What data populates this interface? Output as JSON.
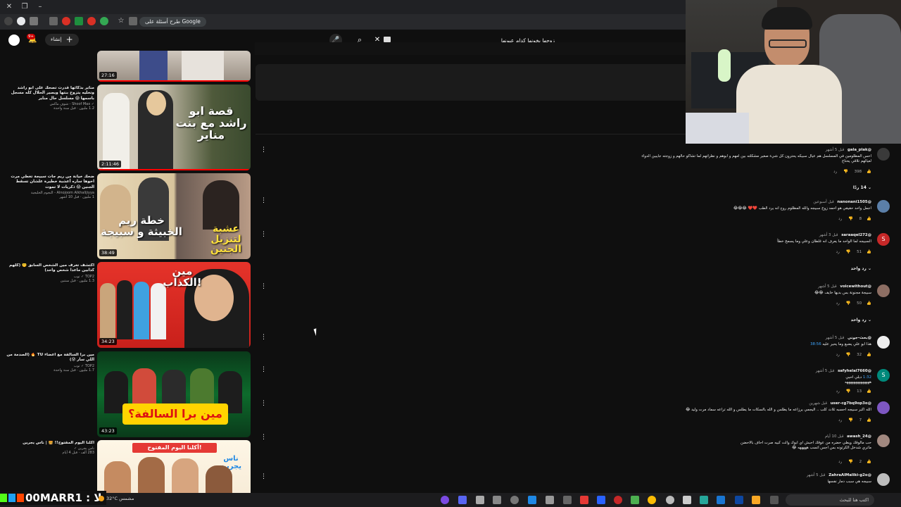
{
  "browser": {
    "ask_google_label": "طرح أسئلة على Google"
  },
  "youtube": {
    "search_value": "زوجها يخونها كدام عيونها",
    "create_label": "إنشاء",
    "notification_count": "9+"
  },
  "videos": [
    {
      "duration": "27:16",
      "title": "",
      "channel": "",
      "meta": ""
    },
    {
      "duration": "2:11:46",
      "thumb_text": "قصة ابو راشد مع بنت مناير",
      "title": "مناير بذكائها قدرت تصحك على ابو راشد وتخليه يتزوج بنتها ويصير الحلال كله مسجل باسمها 😱 مسلسل حال مناير",
      "channel": "✓ Shoof Max - شوف ماكس",
      "meta": "1.2 مليون · قبل سنة واحدة"
    },
    {
      "duration": "38:49",
      "thumb_text_left": "خطة ريم الخبيثة و سبيجة",
      "thumb_text_right": "عشبة لتنزيل الجنين",
      "title": "ضحك خيانة من ريم جات سبيجة تعطي مرت اخوها ساره أعشبة خطيرة علشان تسقط الجنين 😱 ذكريات لا تموت",
      "channel": "Alnojoom Alkhalijiyya - النجوم الخليجية",
      "meta": "1 مليون · قبل 10 أشهر"
    },
    {
      "duration": "34:23",
      "thumb_text": "مين الكذاب!",
      "title": "اكتشف تعرف مين الشخص السابق 🤫 (كلهم كذابين ماعدا شخص واحد)",
      "channel": "TOP2 ✓ توب",
      "meta": "1.3 مليون · قبل سنتين"
    },
    {
      "duration": "43:23",
      "thumb_text": "مين برا السالفة؟",
      "title": "مين برا السالفة مع اعضاء TU 🔥 (الصدمة من اللي سار 😰)",
      "channel": "TOP2 ✓ توب",
      "meta": "1.7 مليون · قبل سنة واحدة"
    },
    {
      "duration": "",
      "thumb_text": "أكلنا اليوم المفتوح!",
      "thumb_badge": "ناس يجرين",
      "title": "أكلنا اليوم المفتوح!! 🍔 | ناس يجرين",
      "channel": "ناس يجرين ✓",
      "meta": "283 ألف · قبل 4 أيام"
    }
  ],
  "comments": [
    {
      "author": "@gala_plak",
      "date": "قبل 5 أشهر",
      "text": "احس المظلومين في المسلسل هم عيال سبيكه يحترون كل شيء صغير مشكلته بين امهم و ابوهم و نظراتهم لما تشاكو حالهم و زوجته جايبين الدواء لعيالهم تلاقي يحتاج",
      "likes": "398",
      "reply_label": "رد",
      "replies": "14 ردًا",
      "avatar_color": "#3a3a3a"
    },
    {
      "author": "@nanonani1505",
      "date": "قبل أسبوعين",
      "text": "اجمل واحد حقيقي هو احمد زوج سبيجه والله المظلوم روح انه يرد الطب ❤️❤️ 😂😂😂",
      "likes": "8",
      "reply_label": "رد",
      "replies": "",
      "avatar_color": "#5b7fa8"
    },
    {
      "author": "@saraaqel272",
      "date": "قبل 3 أشهر",
      "text": "السبيجه لما الواحد ما يعرف انه غلطان وعلي وما يسمح خطأ",
      "likes": "51",
      "reply_label": "رد",
      "replies": "رد واحد",
      "avatar_color": "#c62828",
      "avatar_letter": "S"
    },
    {
      "author": "@voicewithout",
      "date": "قبل 5 أشهر",
      "text": "سبيجة مجنونة بس بديها خايف 😂😂",
      "likes": "50",
      "reply_label": "رد",
      "replies": "رد واحد",
      "avatar_color": "#8d6e63"
    },
    {
      "author": "@بحث-جوني",
      "date": "قبل 5 أشهر",
      "text": "هذا ابو علي يضبع وما يحير عليه",
      "time_link": "38:56",
      "likes": "32",
      "reply_label": "رد",
      "replies": "",
      "avatar_color": "#eeeeee"
    },
    {
      "author": "@safyhelal7660",
      "date": "قبل 5 أشهر",
      "text": "دبلي احبي",
      "time_link": "1:32",
      "extra": "ههههههههههههههه",
      "likes": "13",
      "reply_label": "رد",
      "replies": "",
      "avatar_color": "#00897b",
      "avatar_letter": "S"
    },
    {
      "author": "@user-cg7bq9op3o",
      "date": "قبل شهرين",
      "text": "الله اكبر سبيجه احسبه ثلاث كلب .. اليجمي يرزاعه ما يطلس و الله بالسكات ما يطلس و الله تراعه سماد مرت وليد 😂",
      "likes": "7",
      "reply_label": "رد",
      "replies": "",
      "avatar_color": "#7e57c2"
    },
    {
      "author": "@awash_24",
      "date": "قبل 10 أيام",
      "text": "حب مالوقك ويطي حضره من عوقك احبش اي ابوك والت كبيه صرت احاف بالاحضن ماتري شدخل الكرتونه بس اجس اتسب هههههه 😂",
      "likes": "2",
      "reply_label": "رد",
      "replies": "",
      "avatar_color": "#a1887f"
    },
    {
      "author": "@ZahraAlMaliki-g2o",
      "date": "قبل 5 أشهر",
      "text": "سبيجه هي سبب دمار نفسها",
      "likes": "",
      "reply_label": "",
      "replies": "",
      "avatar_color": "#bdbdbd"
    }
  ],
  "taskbar": {
    "stream_name": "00MARR1 : لا",
    "weather": "32°C مشمس",
    "search_placeholder": "اكتب هنا للبحث"
  },
  "colors": {
    "background": "#0f0f0f",
    "accent_red": "#ff0000",
    "link_blue": "#3ea6ff"
  },
  "icons": {
    "search": "search-icon",
    "mic": "microphone-icon",
    "bell": "bell-icon",
    "more": "more-vertical-icon",
    "like": "thumbs-up-icon",
    "dislike": "thumbs-down-icon",
    "chevron": "chevron-down-icon"
  }
}
